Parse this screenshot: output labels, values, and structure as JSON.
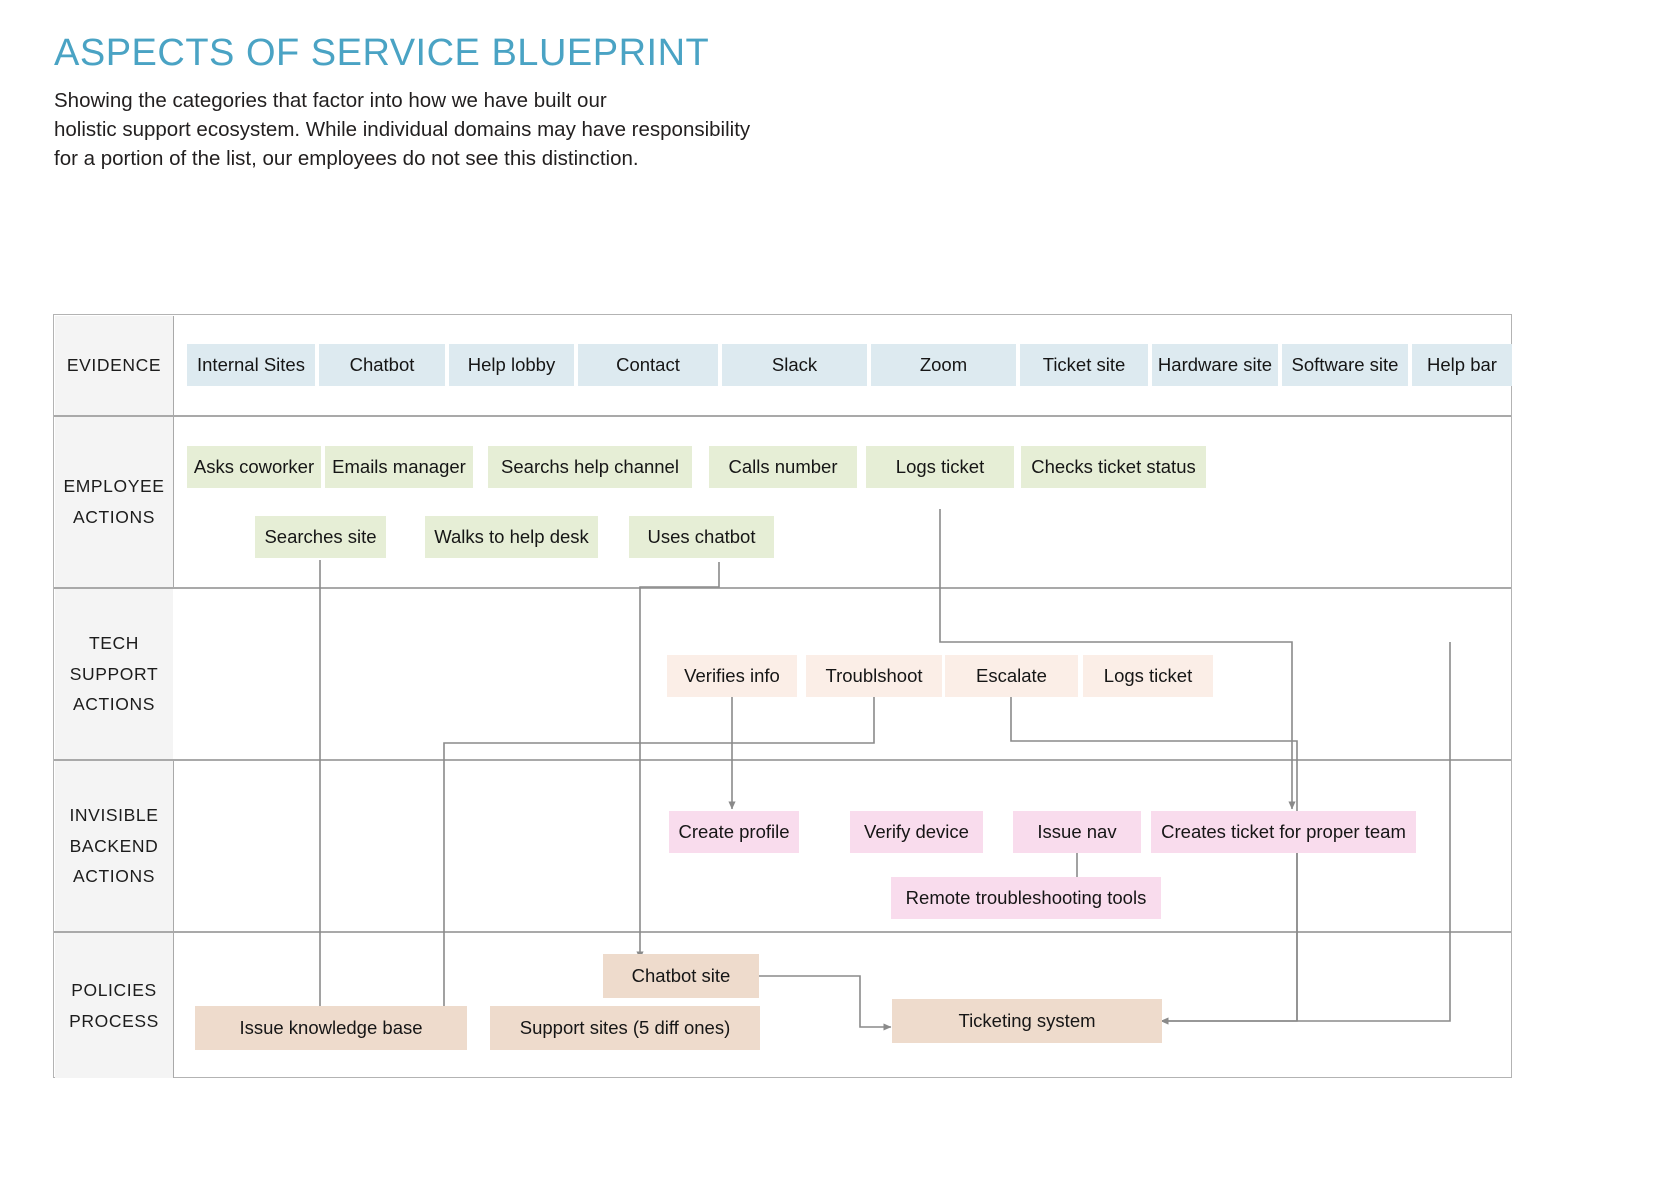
{
  "header": {
    "title": "ASPECTS OF SERVICE BLUEPRINT",
    "subtitle": "Showing the categories that factor into how we have built our\nholistic support ecosystem. While individual domains may have responsibility\nfor a portion of the list, our employees do not see this distinction."
  },
  "colors": {
    "title": "#4aa3c4",
    "evidence_box": "#ddeaf0",
    "employee_box": "#e6eed6",
    "tech_box": "#fbeee7",
    "invisible_box": "#f9dced",
    "policies_box": "#eedbcc",
    "row_label_bg": "#f4f4f4",
    "line": "#8a8a8a"
  },
  "bands": [
    {
      "key": "evidence",
      "label_lines": [
        "EVIDENCE"
      ]
    },
    {
      "key": "employee",
      "label_lines": [
        "EMPLOYEE",
        "ACTIONS"
      ]
    },
    {
      "key": "tech",
      "label_lines": [
        "TECH",
        "SUPPORT",
        "ACTIONS"
      ]
    },
    {
      "key": "invisible",
      "label_lines": [
        "INVISIBLE",
        "BACKEND",
        "ACTIONS"
      ]
    },
    {
      "key": "policies",
      "label_lines": [
        "POLICIES",
        "PROCESS"
      ]
    }
  ],
  "evidence": {
    "items": [
      {
        "label": "Internal Sites"
      },
      {
        "label": "Chatbot"
      },
      {
        "label": "Help lobby"
      },
      {
        "label": "Contact"
      },
      {
        "label": "Slack"
      },
      {
        "label": "Zoom"
      },
      {
        "label": "Ticket site"
      },
      {
        "label": "Hardware site"
      },
      {
        "label": "Software site"
      },
      {
        "label": "Help bar"
      }
    ]
  },
  "employee": {
    "items": [
      {
        "label": "Asks coworker"
      },
      {
        "label": "Emails manager"
      },
      {
        "label": "Searchs help channel"
      },
      {
        "label": "Calls number"
      },
      {
        "label": "Logs ticket"
      },
      {
        "label": "Checks ticket status"
      },
      {
        "label": "Searches site"
      },
      {
        "label": "Walks to help desk"
      },
      {
        "label": "Uses chatbot"
      }
    ]
  },
  "tech": {
    "items": [
      {
        "label": "Verifies info"
      },
      {
        "label": "Troublshoot"
      },
      {
        "label": "Escalate"
      },
      {
        "label": "Logs ticket"
      }
    ]
  },
  "invisible": {
    "items": [
      {
        "label": "Create profile"
      },
      {
        "label": "Verify device"
      },
      {
        "label": "Issue nav"
      },
      {
        "label": "Creates ticket for proper team"
      },
      {
        "label": "Remote troubleshooting tools"
      }
    ]
  },
  "policies": {
    "items": [
      {
        "label": "Chatbot site"
      },
      {
        "label": "Issue knowledge base"
      },
      {
        "label": "Support sites (5 diff ones)"
      },
      {
        "label": "Ticketing system"
      }
    ]
  }
}
